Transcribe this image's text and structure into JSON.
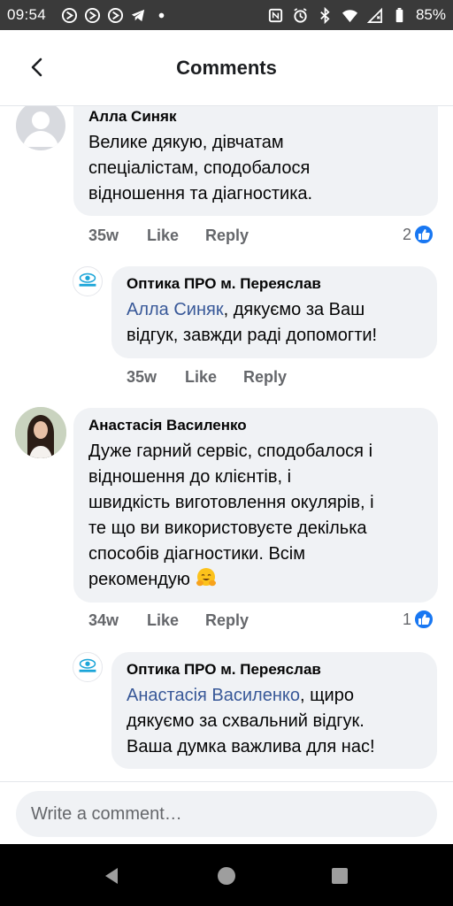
{
  "status_bar": {
    "time": "09:54",
    "battery": "85%",
    "icons": [
      "vpn-circle-icon",
      "vpn-circle-icon",
      "vpn-circle-icon",
      "telegram-icon",
      "dot-icon",
      "nfc-icon",
      "alarm-icon",
      "bluetooth-icon",
      "wifi-icon",
      "no-sim-icon",
      "battery-icon"
    ]
  },
  "header": {
    "title": "Comments",
    "back_icon": "back-arrow-icon"
  },
  "comments": [
    {
      "author": "Алла Синяк",
      "lines": [
        "Велике дякую, дівчатам",
        "спеціалістам, сподобалося",
        "відношення та діагностика."
      ],
      "time": "35w",
      "like_label": "Like",
      "reply_label": "Reply",
      "reactions": "2"
    },
    {
      "author": "Оптика ПРО м. Переяслав",
      "mention": "Алла Синяк",
      "lines": [
        ", дякуємо за Ваш",
        "відгук, завжди раді допомогти!"
      ],
      "time": "35w",
      "like_label": "Like",
      "reply_label": "Reply"
    },
    {
      "author": "Анастасія Василенко",
      "lines": [
        "Дуже гарний сервіс, сподобалося і",
        "відношення до клієнтів, і",
        "швидкість виготовлення окулярів, і",
        "те що ви використовуєте декілька",
        "способів діагностики. Всім",
        "рекомендую"
      ],
      "emoji": "smiling-face-with-open-hands",
      "time": "34w",
      "like_label": "Like",
      "reply_label": "Reply",
      "reactions": "1"
    },
    {
      "author": "Оптика ПРО м. Переяслав",
      "mention": "Анастасія Василенко",
      "lines": [
        ", щиро",
        "дякуємо за схвальний відгук.",
        "Ваша думка важлива для нас!"
      ]
    }
  ],
  "composer": {
    "placeholder": "Write a comment…"
  },
  "colors": {
    "link": "#385898",
    "bubble": "#f0f2f5",
    "like_blue": "#1877f2",
    "muted": "#65676b"
  }
}
